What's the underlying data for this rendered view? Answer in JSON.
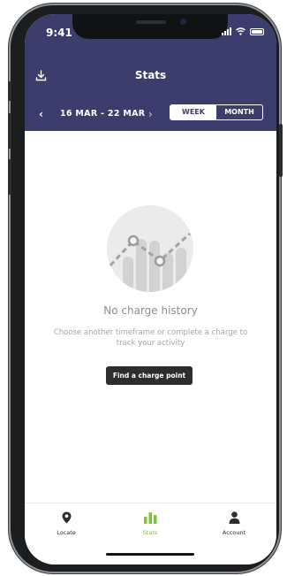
{
  "status_bar": {
    "time": "9:41"
  },
  "header": {
    "title": "Stats",
    "date_range": "16 MAR - 22 MAR",
    "toggle": {
      "week_label": "WEEK",
      "month_label": "MONTH",
      "selected": "WEEK"
    }
  },
  "empty_state": {
    "title": "No charge history",
    "message": "Choose another timeframe or complete a charge to track your activity",
    "button_label": "Find a charge point"
  },
  "tabbar": {
    "items": [
      {
        "label": "Locate",
        "icon": "location-pin-icon",
        "active": false
      },
      {
        "label": "Stats",
        "icon": "bar-chart-icon",
        "active": true
      },
      {
        "label": "Account",
        "icon": "person-icon",
        "active": false
      }
    ]
  },
  "colors": {
    "header_bg": "#3b3e6c",
    "active_tab": "#7cc33b",
    "inactive_tab": "#2d2d2d",
    "button_bg": "#2d2d2d"
  }
}
